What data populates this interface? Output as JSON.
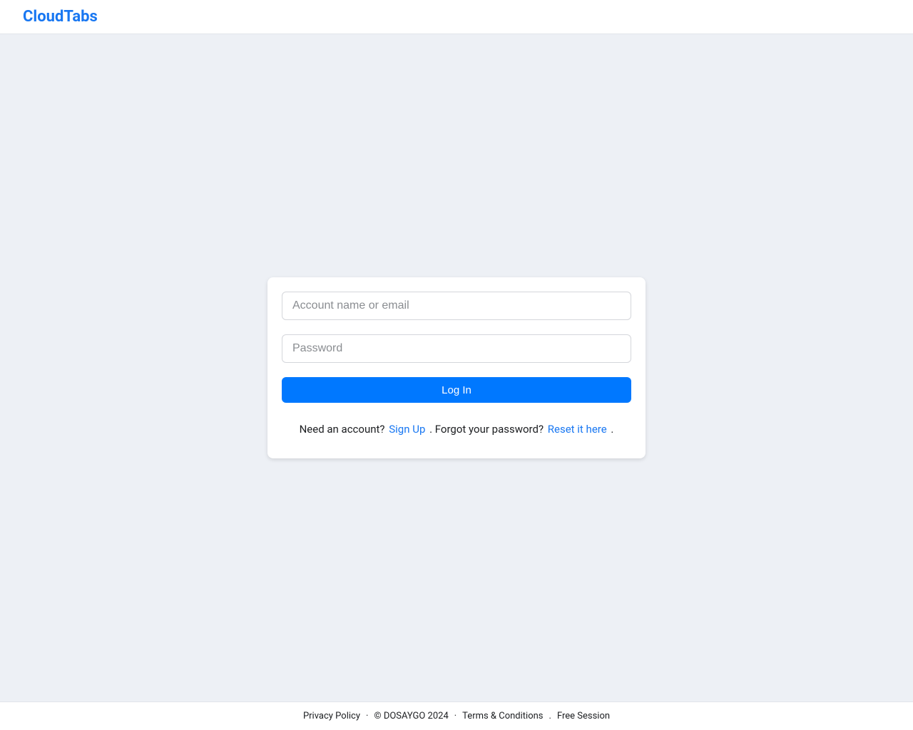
{
  "header": {
    "brand": "CloudTabs"
  },
  "form": {
    "username_placeholder": "Account name or email",
    "username_value": "",
    "password_placeholder": "Password",
    "password_value": "",
    "submit_label": "Log In"
  },
  "helper": {
    "need_account_text": "Need an account? ",
    "signup_link": "Sign Up",
    "sep1": " . ",
    "forgot_text": "Forgot your password? ",
    "reset_link": "Reset it here",
    "sep2": " ."
  },
  "footer": {
    "privacy": "Privacy Policy",
    "sep": " · ",
    "copyright": "© DOSAYGO 2024",
    "terms": "Terms & Conditions",
    "dot": " . ",
    "free_session": "Free Session"
  }
}
